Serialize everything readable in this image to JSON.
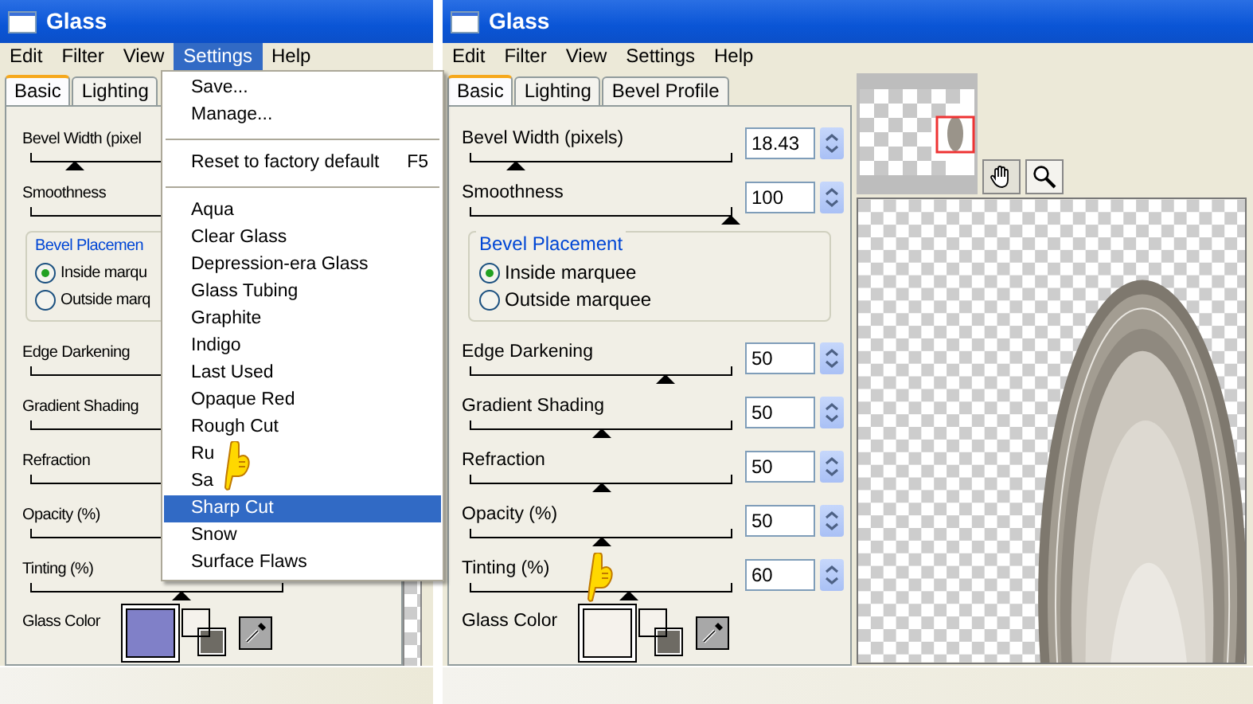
{
  "dialogs": [
    {
      "title": "Glass",
      "menu_bar": [
        {
          "label": "Edit",
          "selected": false
        },
        {
          "label": "Filter",
          "selected": false
        },
        {
          "label": "View",
          "selected": false
        },
        {
          "label": "Settings",
          "selected": true
        },
        {
          "label": "Help",
          "selected": false
        }
      ],
      "tabs": [
        {
          "label": "Basic",
          "selected": true
        },
        {
          "label": "Lighting",
          "selected": false
        }
      ],
      "controls": [
        {
          "kind": "slider",
          "label": "Bevel Width (pixel",
          "level": 0.17
        },
        {
          "kind": "slider",
          "label": "Smoothness"
        },
        {
          "kind": "radio_group",
          "title": "Bevel Placemen",
          "options": [
            {
              "label": "Inside marqu",
              "selected": true
            },
            {
              "label": "Outside marq",
              "selected": false
            }
          ]
        },
        {
          "kind": "slider",
          "label": "Edge Darkening"
        },
        {
          "kind": "slider",
          "label": "Gradient Shading"
        },
        {
          "kind": "slider",
          "label": "Refraction"
        },
        {
          "kind": "slider",
          "label": "Opacity (%)"
        },
        {
          "kind": "slider",
          "label": "Tinting (%)",
          "level": 0.6
        }
      ],
      "glass_color": {
        "label": "Glass Color",
        "color": "#8080c8"
      }
    },
    {
      "title": "Glass",
      "menu_bar": [
        {
          "label": "Edit",
          "selected": false
        },
        {
          "label": "Filter",
          "selected": false
        },
        {
          "label": "View",
          "selected": false
        },
        {
          "label": "Settings",
          "selected": false
        },
        {
          "label": "Help",
          "selected": false
        }
      ],
      "tabs": [
        {
          "label": "Basic",
          "selected": true
        },
        {
          "label": "Lighting",
          "selected": false
        },
        {
          "label": "Bevel Profile",
          "selected": false
        }
      ],
      "controls": [
        {
          "kind": "slider",
          "label": "Bevel Width (pixels)",
          "level": 0.17,
          "value": "18.43"
        },
        {
          "kind": "slider",
          "label": "Smoothness",
          "level": 1,
          "value": "100"
        },
        {
          "kind": "radio_group",
          "title": "Bevel Placement",
          "options": [
            {
              "label": "Inside marquee",
              "selected": true
            },
            {
              "label": "Outside marquee",
              "selected": false
            }
          ]
        },
        {
          "kind": "slider",
          "label": "Edge Darkening",
          "level": 0.75,
          "value": "50"
        },
        {
          "kind": "slider",
          "label": "Gradient Shading",
          "level": 0.5,
          "value": "50"
        },
        {
          "kind": "slider",
          "label": "Refraction",
          "level": 0.5,
          "value": "50"
        },
        {
          "kind": "slider",
          "label": "Opacity (%)",
          "level": 0.5,
          "value": "50"
        },
        {
          "kind": "slider",
          "label": "Tinting (%)",
          "level": 0.61,
          "value": "60"
        }
      ],
      "glass_color": {
        "label": "Glass Color",
        "color": "#f5f2ec"
      }
    }
  ],
  "settings_menu": {
    "items": [
      {
        "kind": "command",
        "label": "Save...",
        "selected": false
      },
      {
        "kind": "command",
        "label": "Manage...",
        "selected": false
      },
      {
        "kind": "separator"
      },
      {
        "kind": "command",
        "label": "Reset to factory default",
        "shortcut": "F5",
        "selected": false
      },
      {
        "kind": "separator"
      },
      {
        "kind": "command",
        "label": "Aqua",
        "selected": false
      },
      {
        "kind": "command",
        "label": "Clear Glass",
        "selected": false
      },
      {
        "kind": "command",
        "label": "Depression-era Glass",
        "selected": false
      },
      {
        "kind": "command",
        "label": "Glass Tubing",
        "selected": false
      },
      {
        "kind": "command",
        "label": "Graphite",
        "selected": false
      },
      {
        "kind": "command",
        "label": "Indigo",
        "selected": false
      },
      {
        "kind": "command",
        "label": "Last Used",
        "selected": false
      },
      {
        "kind": "command",
        "label": "Opaque Red",
        "selected": false
      },
      {
        "kind": "command",
        "label": "Rough Cut",
        "selected": false
      },
      {
        "kind": "command",
        "label": "Ru",
        "selected": false
      },
      {
        "kind": "command",
        "label": "Sa",
        "selected": false
      },
      {
        "kind": "command",
        "label": "Sharp Cut",
        "selected": true
      },
      {
        "kind": "command",
        "label": "Snow",
        "selected": false
      },
      {
        "kind": "command",
        "label": "Surface Flaws",
        "selected": false
      }
    ]
  }
}
